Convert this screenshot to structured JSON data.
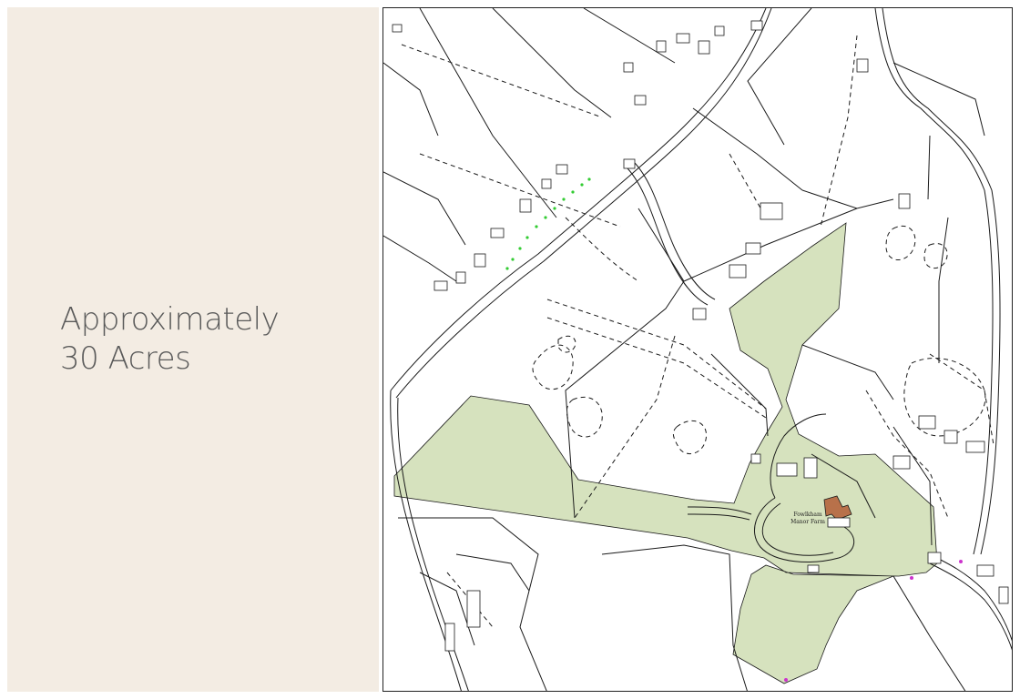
{
  "panel": {
    "line1": "Approximately",
    "line2": "30 Acres"
  },
  "map": {
    "labels": {
      "farm_line1": "Fowlkham",
      "farm_line2": "Manor Farm"
    },
    "colors": {
      "property_fill": "#d6e2be",
      "farmhouse": "#b8714a",
      "boundary_dots": "#33cc33",
      "boundary_pins": "#cc33cc",
      "panel_bg": "#f3ece3"
    }
  }
}
